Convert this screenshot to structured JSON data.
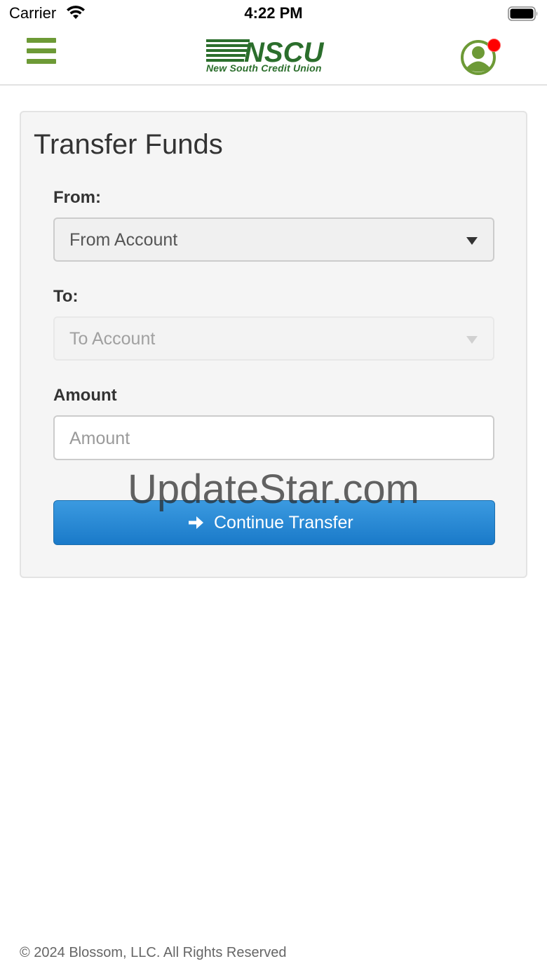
{
  "status_bar": {
    "carrier": "Carrier",
    "time": "4:22 PM",
    "wifi_icon": "wifi-icon",
    "battery_icon": "battery-icon"
  },
  "header": {
    "menu_icon": "hamburger-menu-icon",
    "logo": {
      "wordmark": "NSCU",
      "tagline": "New South Credit Union"
    },
    "profile_icon": "user-profile-icon",
    "notification_dot_color": "#ff0000"
  },
  "transfer": {
    "title": "Transfer Funds",
    "from_label": "From:",
    "from_selected": "From Account",
    "to_label": "To:",
    "to_selected": "To Account",
    "to_disabled": true,
    "amount_label": "Amount",
    "amount_placeholder": "Amount",
    "amount_value": "",
    "continue_label": "Continue Transfer",
    "continue_icon": "arrow-right-icon"
  },
  "watermark": "UpdateStar.com",
  "footer": {
    "copyright": "© 2024 Blossom, LLC. All Rights Reserved"
  },
  "colors": {
    "brand_green": "#6d9a36",
    "logo_green": "#2b6e2c",
    "primary_blue": "#1a7ac9",
    "panel_bg": "#f5f5f5"
  }
}
